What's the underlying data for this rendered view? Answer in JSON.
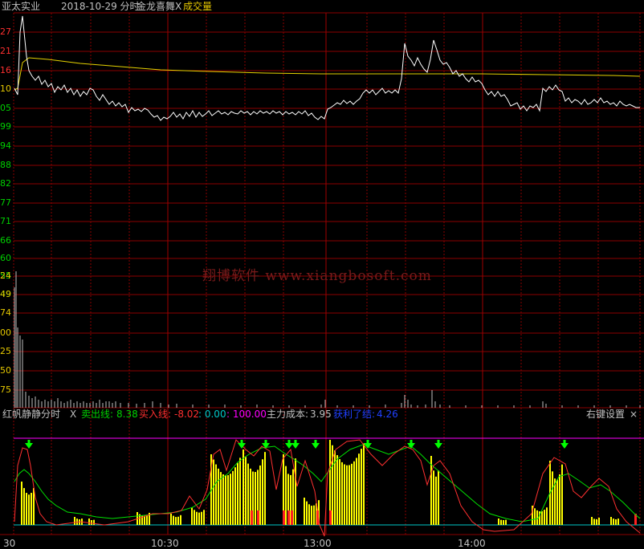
{
  "header": {
    "stock_name": "亚太实业",
    "date_label": "2018-10-29 分时",
    "indicator_name": "金龙喜舞",
    "indicator_close": "X",
    "volume_label": "成交量"
  },
  "watermark": "翔博软件 www.xiangbosoft.com",
  "price_axis_labels": [
    "27",
    "21",
    "16",
    "10",
    "05",
    "99",
    "94",
    "88",
    "82",
    "77",
    "71",
    "66",
    "60",
    "55",
    "49"
  ],
  "volume_axis_labels": [
    "24",
    "49",
    "74",
    "00",
    "25",
    "50",
    "75"
  ],
  "indicator_header": {
    "name": "红帆静静分时",
    "close": "X",
    "sell_line_label": "卖出线:",
    "sell_line_value": "8.38",
    "buy_line_label": "买入线:",
    "buy_line_value": "-8.02",
    "zero_label": ": 0.00",
    "hundred_label": ": 100.00",
    "main_cost_label": "主力成本:",
    "main_cost_value": "3.95",
    "profit_label": "获利了结:",
    "profit_value": "4.26",
    "settings_label": "右键设置",
    "settings_close": "×"
  },
  "time_axis_labels": [
    "30",
    "10:30",
    "13:00",
    "14:00"
  ],
  "colors": {
    "grid": "#8b0000",
    "price_line": "#ffffff",
    "avg_line": "#e6d200",
    "volume_bar": "#c0c0c0",
    "sell_line": "#00e000",
    "buy_line": "#ff3030",
    "zero_line": "#00c8c8",
    "hundred_line": "#ff00ff",
    "signal_bar": "#ffff00",
    "red_bar": "#ff2020",
    "arrow": "#00ff00",
    "up_label": "#ff3030",
    "down_label": "#00d000",
    "yellow_label": "#e6c800"
  }
}
